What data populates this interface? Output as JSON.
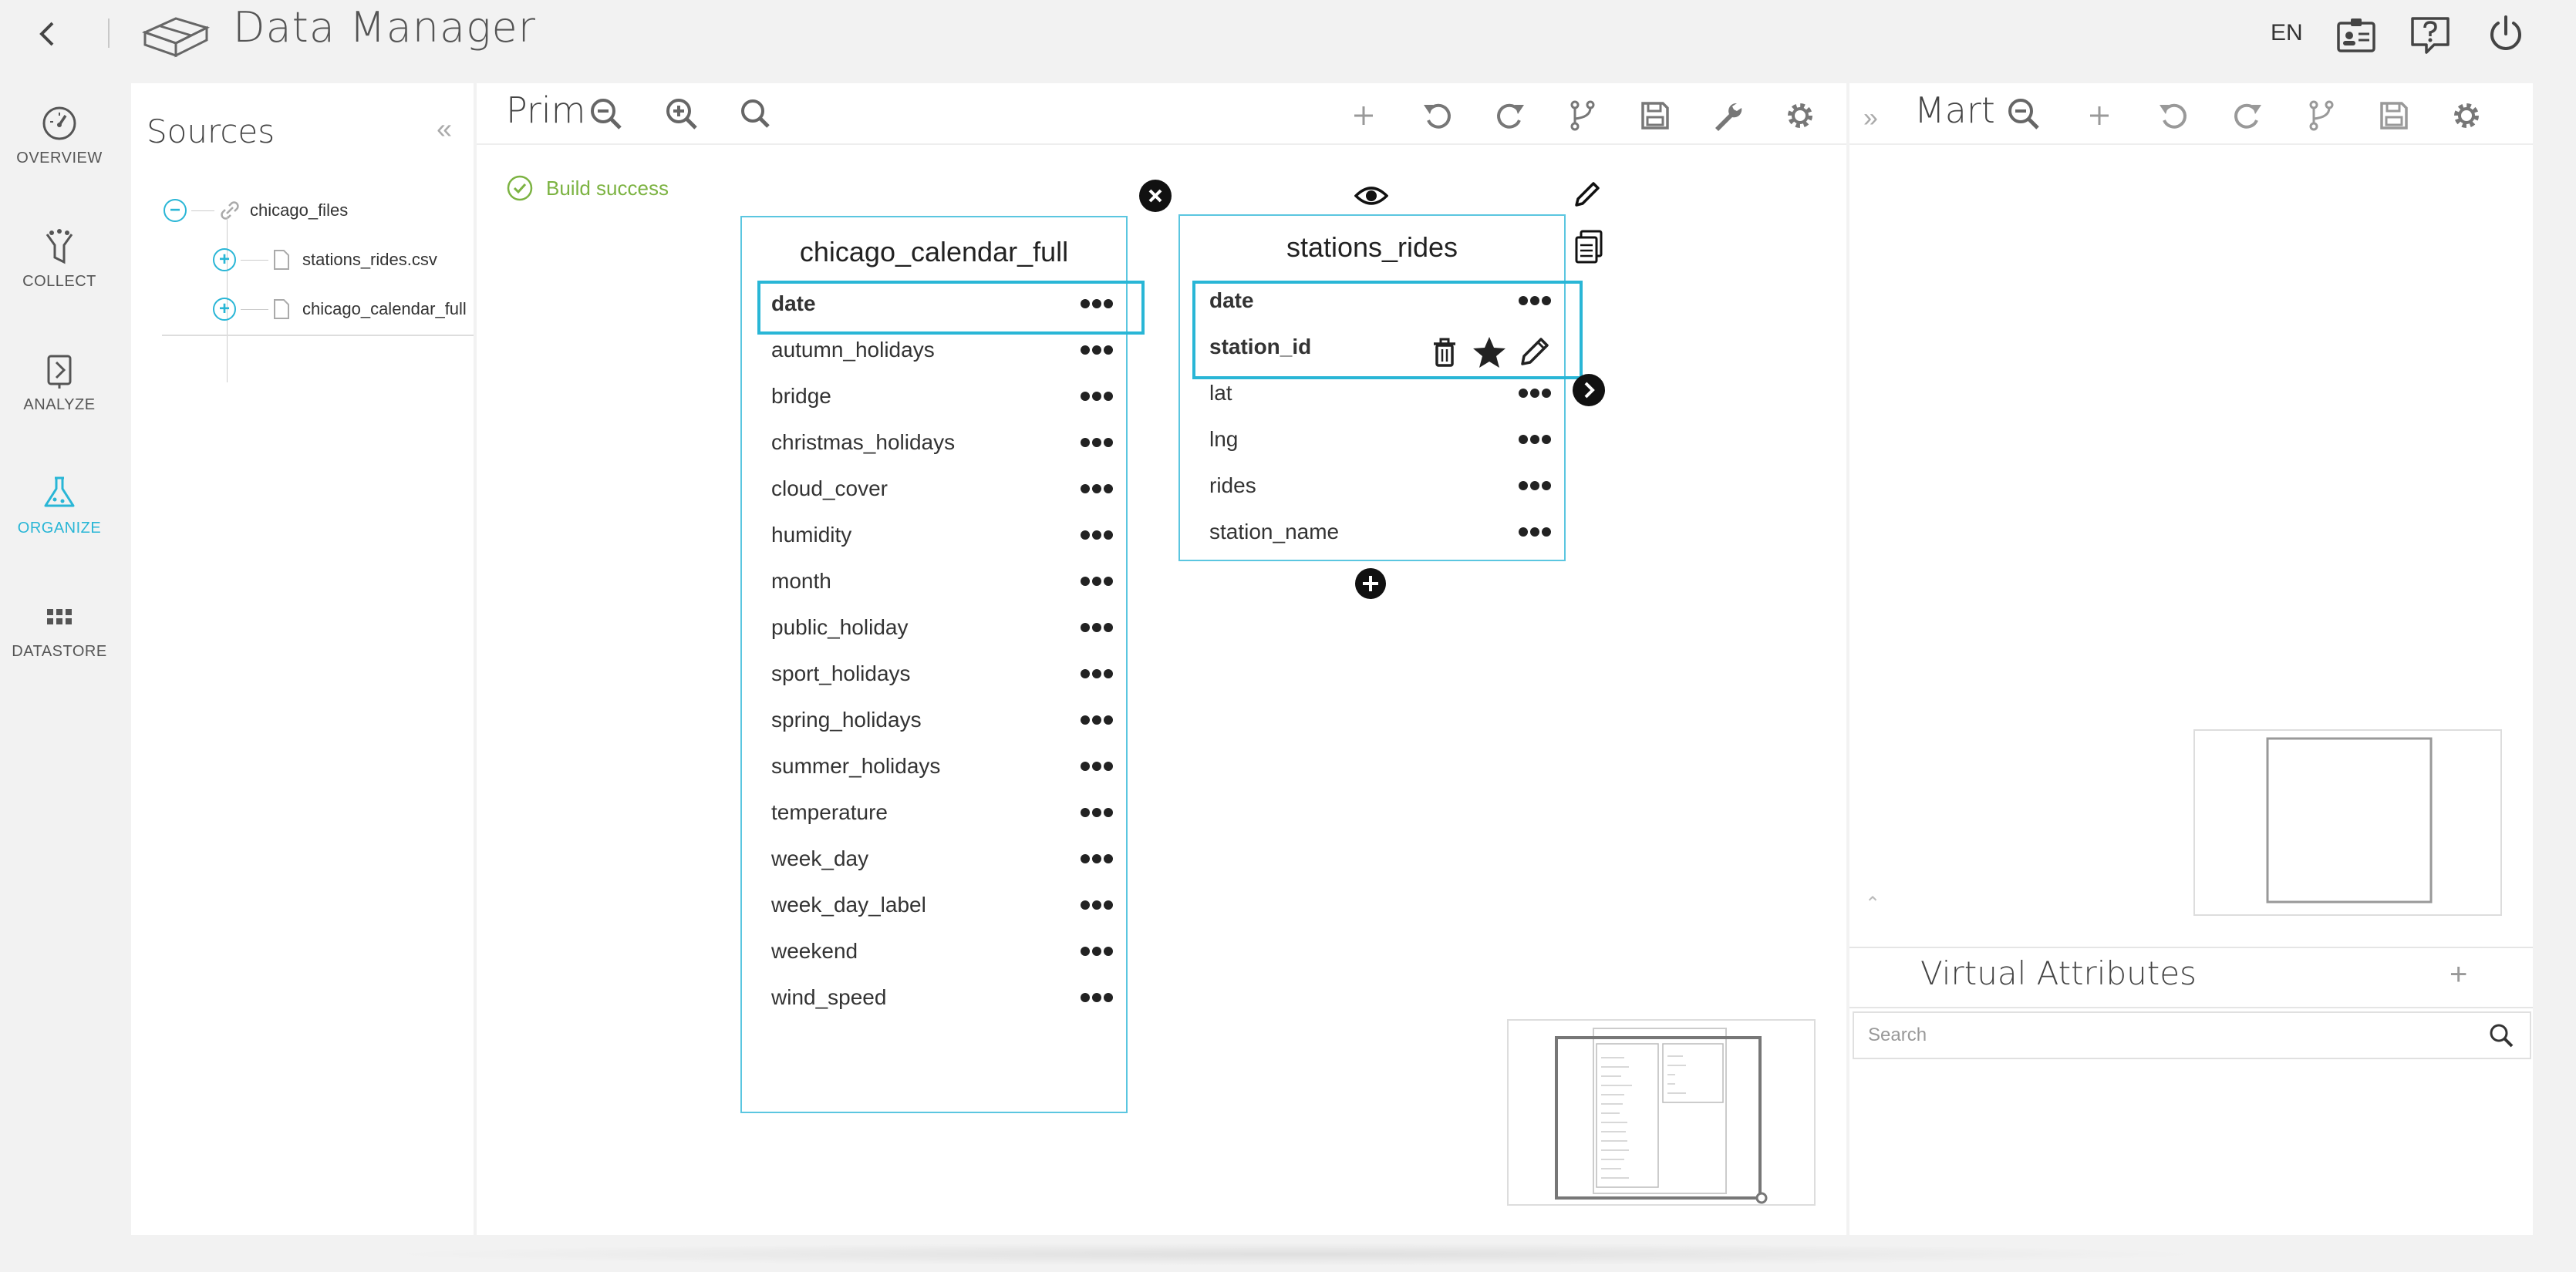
{
  "app": {
    "title": "Data Manager",
    "language": "EN",
    "icons": {
      "back": "chevron-left-icon",
      "logo": "data-manager-logo",
      "profile": "id-badge-icon",
      "help": "help-icon",
      "power": "power-icon"
    }
  },
  "nav": {
    "items": [
      {
        "label": "OVERVIEW",
        "icon": "speedometer-icon",
        "active": false
      },
      {
        "label": "COLLECT",
        "icon": "funnel-icon",
        "active": false
      },
      {
        "label": "ANALYZE",
        "icon": "analyze-icon",
        "active": false
      },
      {
        "label": "ORGANIZE",
        "icon": "flask-icon",
        "active": true
      },
      {
        "label": "DATASTORE",
        "icon": "grid-icon",
        "active": false
      }
    ],
    "active_color": "#29b6d6"
  },
  "sources": {
    "title": "Sources",
    "collapse_icon": "double-chevron-left-icon",
    "root": {
      "label": "chicago_files",
      "expanded": true,
      "icon": "link-icon"
    },
    "children": [
      {
        "label": "stations_rides.csv",
        "icon": "file-icon",
        "expanded": false
      },
      {
        "label": "chicago_calendar_full",
        "icon": "file-icon",
        "expanded": false
      }
    ]
  },
  "prim": {
    "title": "Prim",
    "toolbar": [
      "zoom-out-icon",
      "zoom-in-icon",
      "search-icon",
      "add-icon",
      "undo-icon",
      "redo-icon",
      "branch-icon",
      "save-icon",
      "wrench-icon",
      "gear-icon"
    ],
    "build_status": {
      "text": "Build success",
      "color": "#7cb342"
    },
    "tables": [
      {
        "name": "chicago_calendar_full",
        "attributes": [
          "date",
          "autumn_holidays",
          "bridge",
          "christmas_holidays",
          "cloud_cover",
          "humidity",
          "month",
          "public_holiday",
          "sport_holidays",
          "spring_holidays",
          "summer_holidays",
          "temperature",
          "week_day",
          "week_day_label",
          "weekend",
          "wind_speed"
        ],
        "highlighted": "date"
      },
      {
        "name": "stations_rides",
        "attributes": [
          "date",
          "station_id",
          "lat",
          "lng",
          "rides",
          "station_name"
        ],
        "highlighted_group": [
          "date",
          "station_id"
        ],
        "row_actions": [
          "trash-icon",
          "star-icon",
          "pencil-icon"
        ]
      }
    ],
    "controls": [
      "close-icon",
      "eye-icon",
      "pencil-icon",
      "document-icon",
      "next-arrow-icon",
      "add-circle-icon"
    ],
    "accent": "#29b6d6"
  },
  "mart": {
    "title": "Mart",
    "expand_icon": "double-chevron-right-icon",
    "toolbar": [
      "zoom-out-icon",
      "add-icon",
      "undo-icon",
      "redo-icon",
      "branch-icon",
      "save-icon",
      "gear-icon"
    ],
    "virtual_attributes": {
      "title": "Virtual Attributes",
      "add_icon": "plus-icon",
      "search_placeholder": "Search",
      "search_value": ""
    }
  }
}
